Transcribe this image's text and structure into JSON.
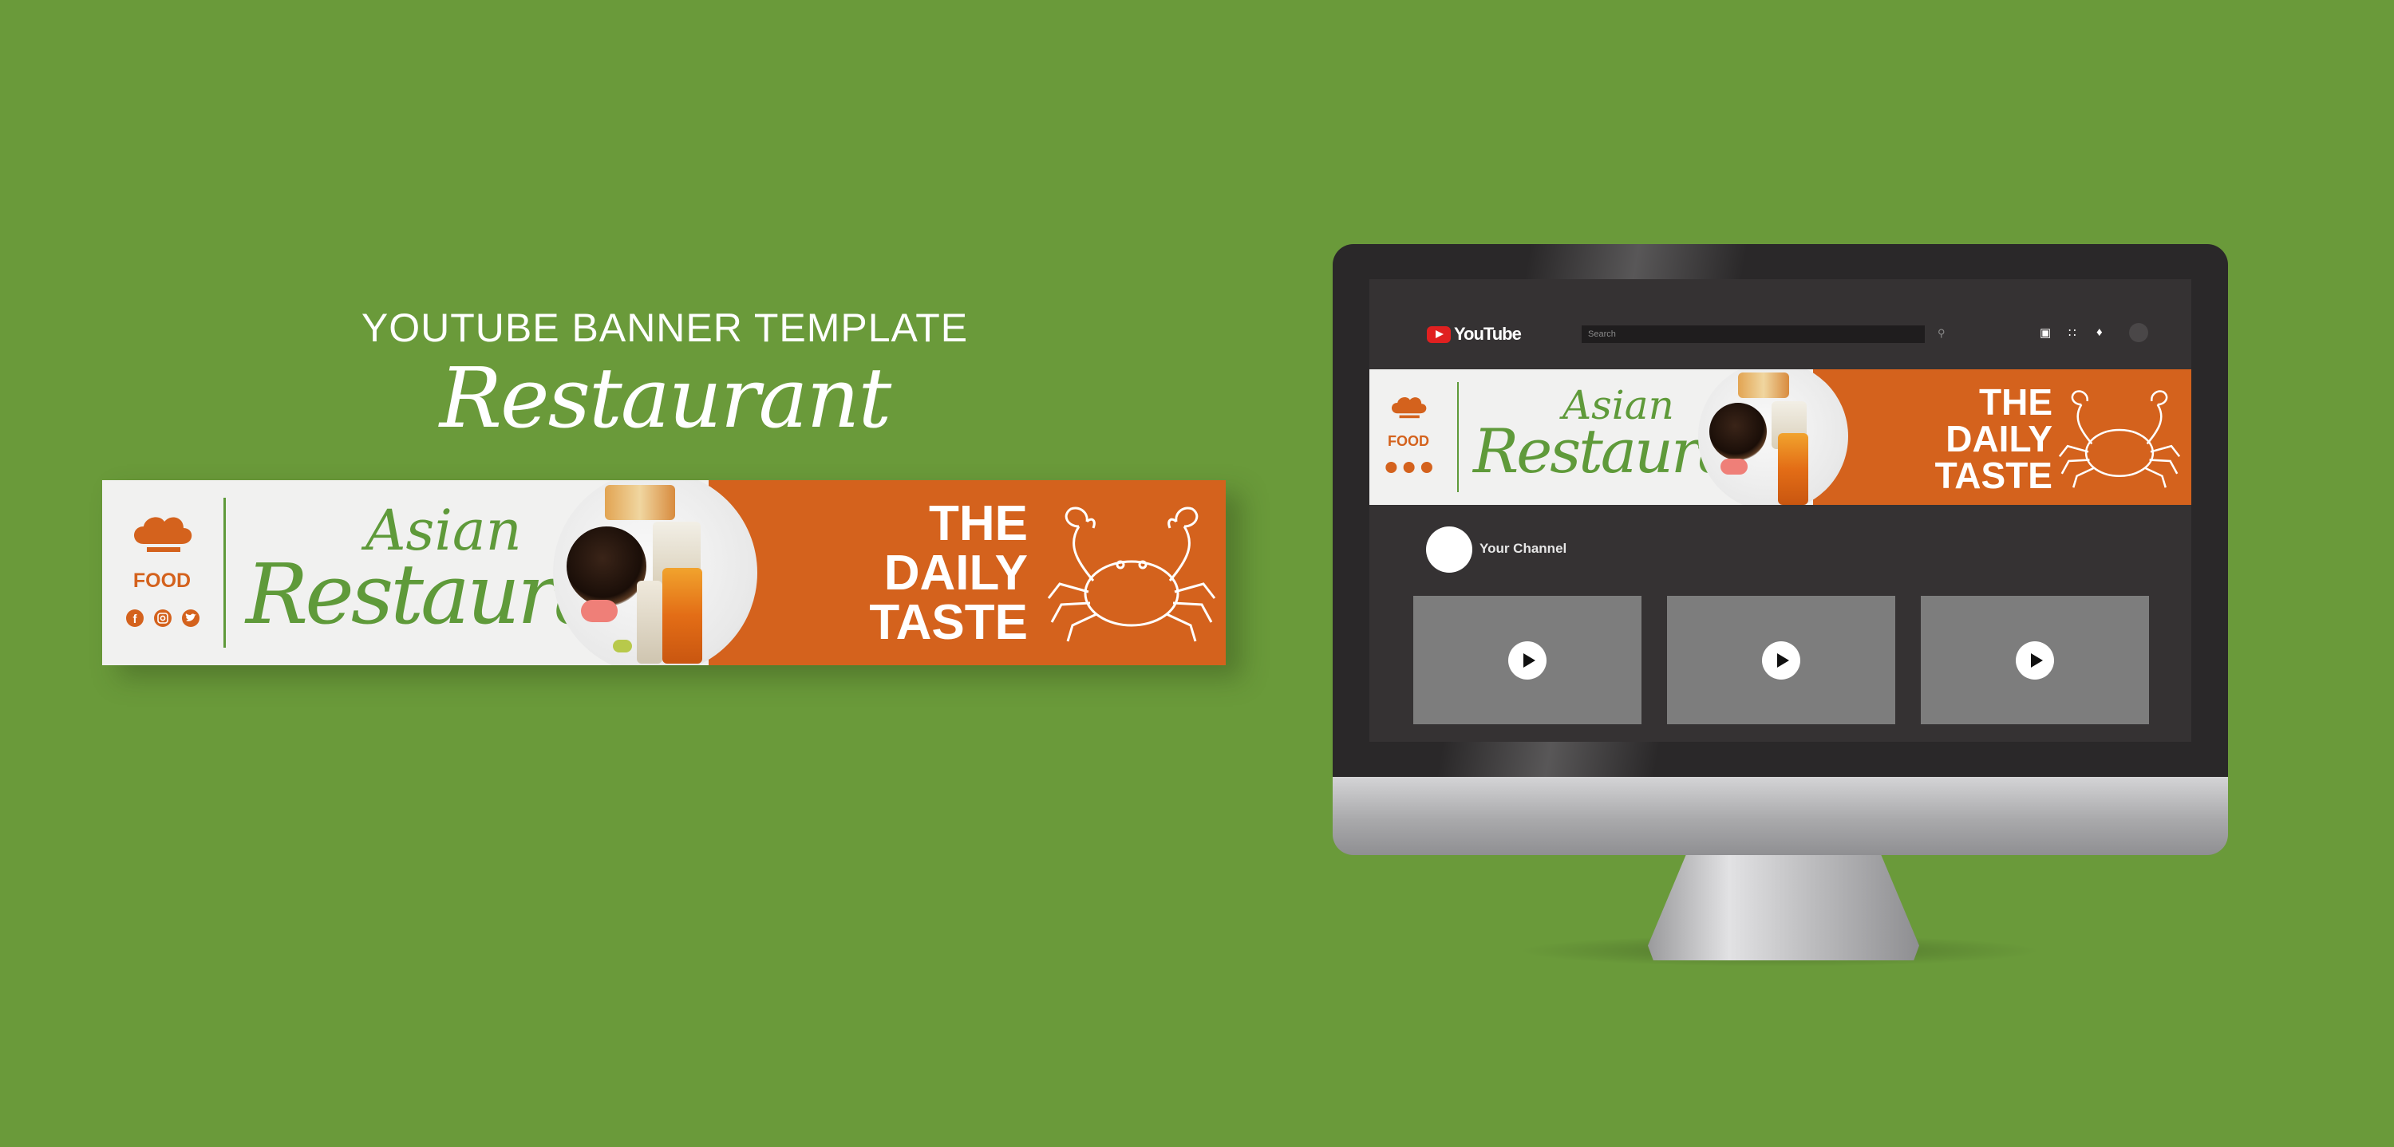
{
  "headline": {
    "title": "YOUTUBE BANNER TEMPLATE",
    "script": "Restaurant"
  },
  "banner": {
    "brand": "FOOD",
    "script_line1": "Asian",
    "script_line2": "Restaurant",
    "tagline": [
      "THE",
      "DAILY",
      "TASTE"
    ],
    "social_icons": [
      "facebook-icon",
      "instagram-icon",
      "twitter-icon"
    ]
  },
  "youtube": {
    "logo_text": "YouTube",
    "search_placeholder": "Search",
    "header_icons": [
      "create-video-icon",
      "apps-grid-icon",
      "notifications-bell-icon"
    ],
    "channel_name": "Your Channel",
    "videos": [
      "video-thumbnail-1",
      "video-thumbnail-2",
      "video-thumbnail-3"
    ]
  },
  "colors": {
    "background": "#6a9a3a",
    "banner_orange": "#d4621d",
    "banner_green": "#5f9a3a",
    "screen": "#353233",
    "bezel": "#2a2829"
  }
}
